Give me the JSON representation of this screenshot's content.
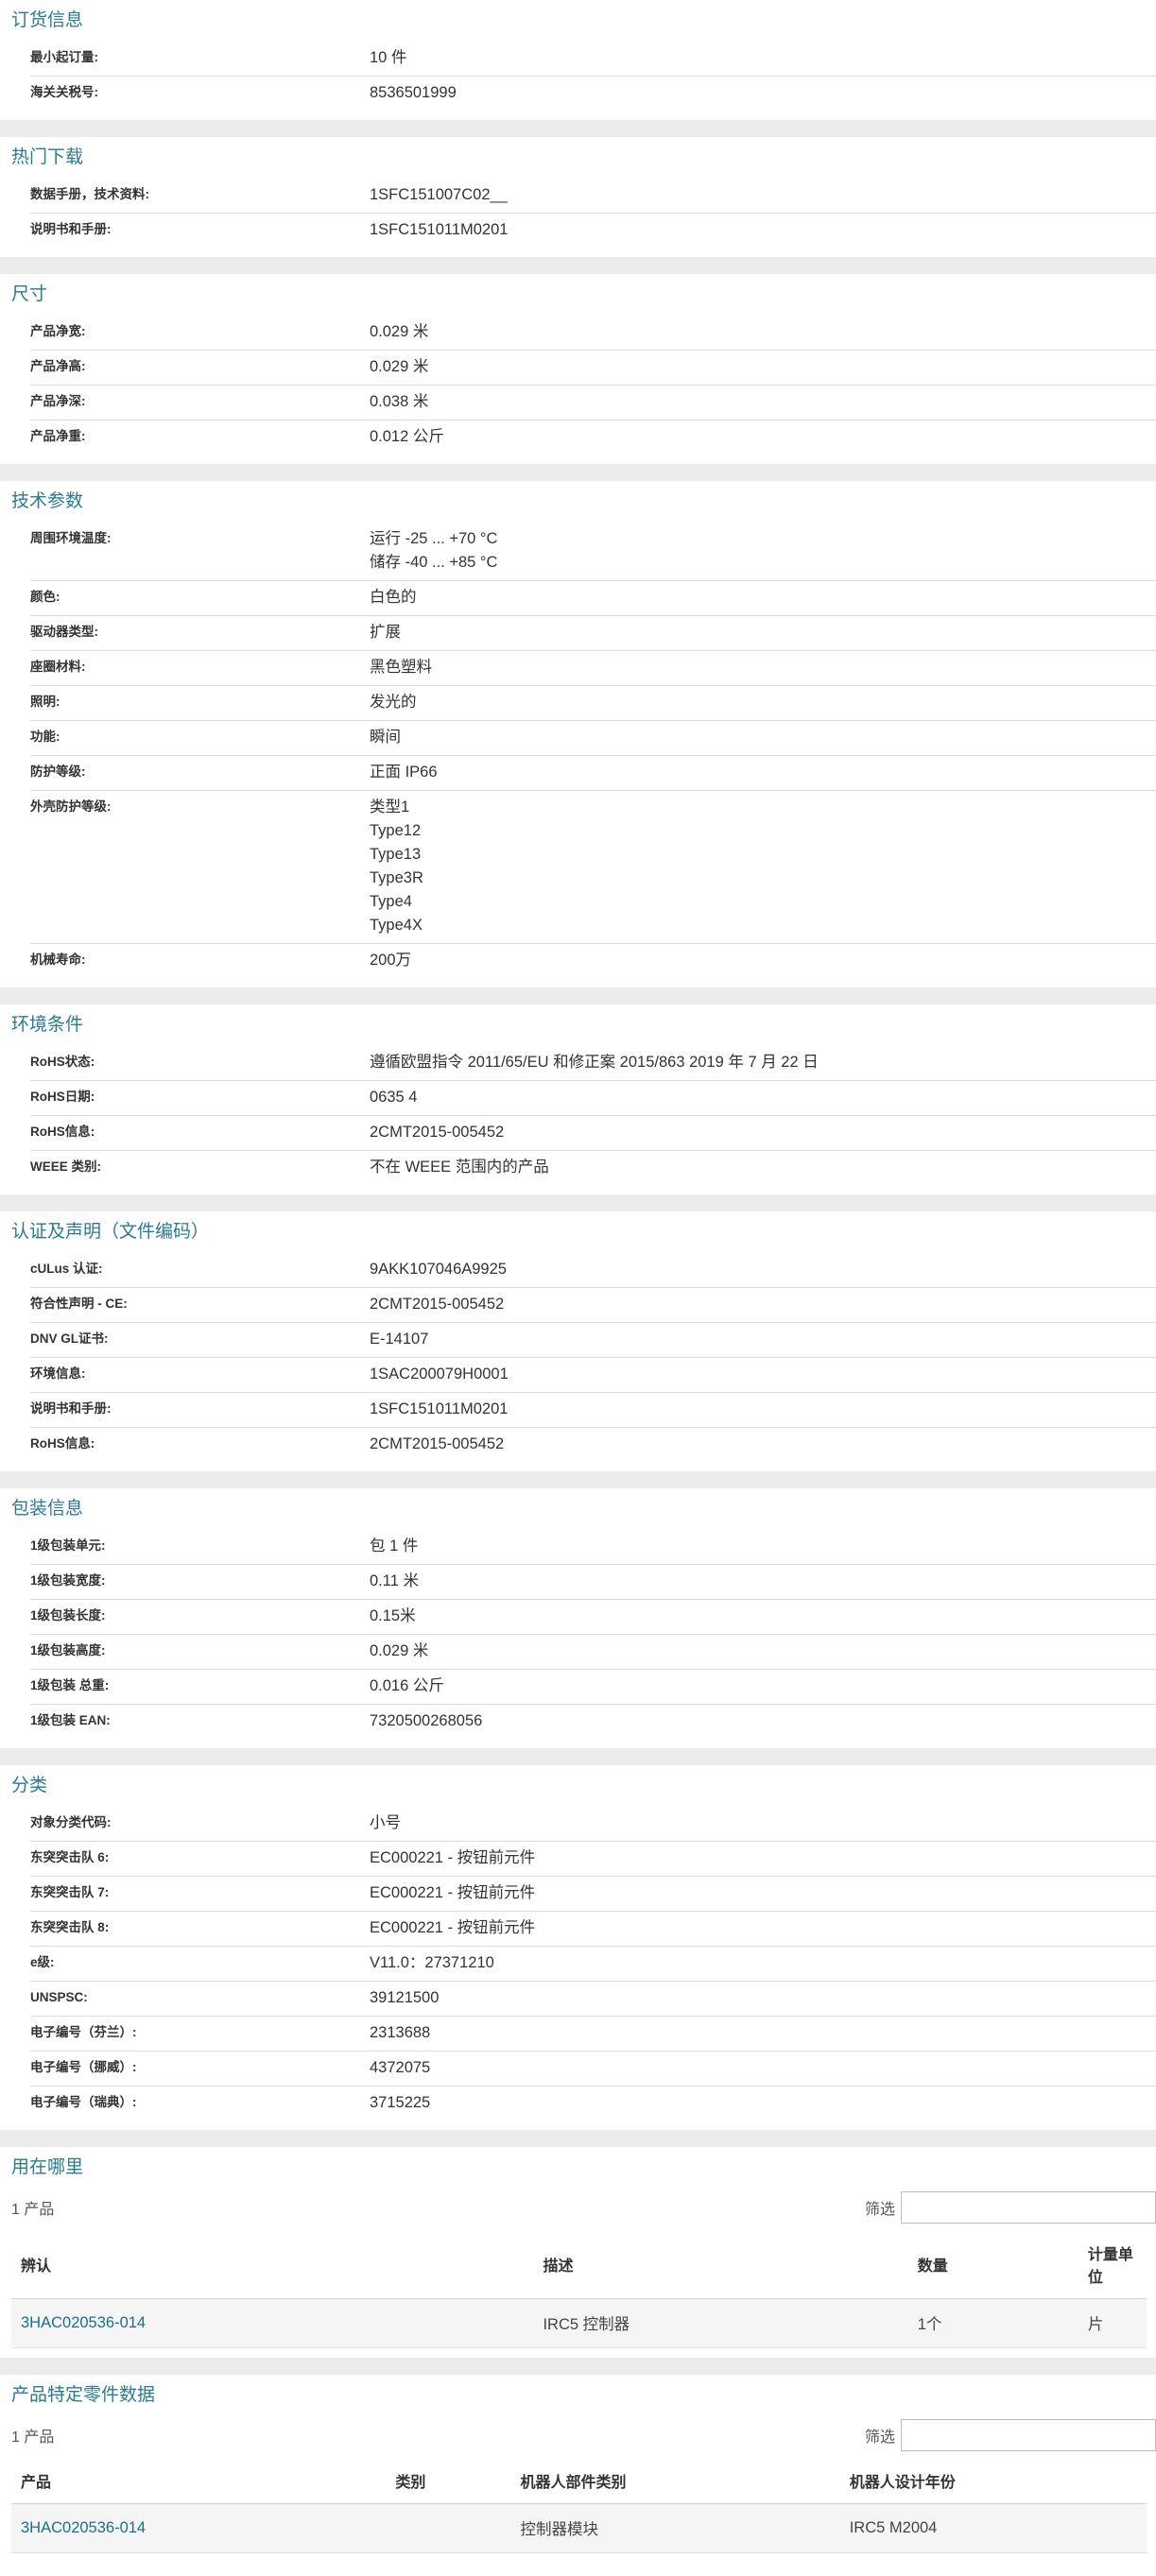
{
  "sections": {
    "ordering": {
      "title": "订货信息",
      "rows": [
        {
          "label": "最小起订量:",
          "value": "10 件"
        },
        {
          "label": "海关关税号:",
          "value": "8536501999"
        }
      ]
    },
    "downloads": {
      "title": "热门下载",
      "rows": [
        {
          "label": "数据手册，技术资料:",
          "value": "1SFC151007C02__"
        },
        {
          "label": "说明书和手册:",
          "value": "1SFC151011M0201"
        }
      ]
    },
    "dimensions": {
      "title": "尺寸",
      "rows": [
        {
          "label": "产品净宽:",
          "value": "0.029 米"
        },
        {
          "label": "产品净高:",
          "value": "0.029 米"
        },
        {
          "label": "产品净深:",
          "value": "0.038 米"
        },
        {
          "label": "产品净重:",
          "value": "0.012 公斤"
        }
      ]
    },
    "technical": {
      "title": "技术参数",
      "rows": [
        {
          "label": "周围环境温度:",
          "lines": [
            "运行 -25 ... +70 °C",
            "储存 -40 ... +85 °C"
          ]
        },
        {
          "label": "颜色:",
          "value": "白色的"
        },
        {
          "label": "驱动器类型:",
          "value": "扩展"
        },
        {
          "label": "座圈材料:",
          "value": "黑色塑料"
        },
        {
          "label": "照明:",
          "value": "发光的"
        },
        {
          "label": "功能:",
          "value": "瞬间"
        },
        {
          "label": "防护等级:",
          "value": "正面 IP66"
        },
        {
          "label": "外壳防护等级:",
          "lines": [
            "类型1",
            "Type12",
            "Type13",
            "Type3R",
            "Type4",
            "Type4X"
          ]
        },
        {
          "label": "机械寿命:",
          "value": "200万"
        }
      ]
    },
    "environment": {
      "title": "环境条件",
      "rows": [
        {
          "label": "RoHS状态:",
          "value": "遵循欧盟指令 2011/65/EU 和修正案 2015/863 2019 年 7 月 22 日"
        },
        {
          "label": "RoHS日期:",
          "value": "0635 4"
        },
        {
          "label": "RoHS信息:",
          "value": "2CMT2015-005452"
        },
        {
          "label": "WEEE 类别:",
          "value": "不在 WEEE 范围内的产品"
        }
      ]
    },
    "certifications": {
      "title": "认证及声明（文件编码）",
      "rows": [
        {
          "label": "cULus 认证:",
          "value": "9AKK107046A9925"
        },
        {
          "label": "符合性声明 - CE:",
          "value": "2CMT2015-005452"
        },
        {
          "label": "DNV GL证书:",
          "value": "E-14107"
        },
        {
          "label": "环境信息:",
          "value": "1SAC200079H0001"
        },
        {
          "label": "说明书和手册:",
          "value": "1SFC151011M0201"
        },
        {
          "label": "RoHS信息:",
          "value": "2CMT2015-005452"
        }
      ]
    },
    "packaging": {
      "title": "包装信息",
      "rows": [
        {
          "label": "1级包装单元:",
          "value": "包 1 件"
        },
        {
          "label": "1级包装宽度:",
          "value": "0.11 米"
        },
        {
          "label": "1级包装长度:",
          "value": "0.15米"
        },
        {
          "label": "1级包装高度:",
          "value": "0.029 米"
        },
        {
          "label": "1级包装 总重:",
          "value": "0.016 公斤"
        },
        {
          "label": "1级包装 EAN:",
          "value": "7320500268056"
        }
      ]
    },
    "classification": {
      "title": "分类",
      "rows": [
        {
          "label": "对象分类代码:",
          "value": "小号"
        },
        {
          "label": "东突突击队 6:",
          "value": "EC000221 - 按钮前元件"
        },
        {
          "label": "东突突击队 7:",
          "value": "EC000221 - 按钮前元件"
        },
        {
          "label": "东突突击队 8:",
          "value": "EC000221 - 按钮前元件"
        },
        {
          "label": "e级:",
          "value": "V11.0：27371210"
        },
        {
          "label": "UNSPSC:",
          "value": "39121500"
        },
        {
          "label": "电子编号（芬兰）:",
          "value": "2313688"
        },
        {
          "label": "电子编号（挪威）:",
          "value": "4372075"
        },
        {
          "label": "电子编号（瑞典）:",
          "value": "3715225"
        }
      ]
    }
  },
  "where_used": {
    "title": "用在哪里",
    "count": "1 产品",
    "filter_label": "筛选",
    "filter_value": "",
    "headers": [
      "辨认",
      "描述",
      "数量",
      "计量单位"
    ],
    "rows": [
      {
        "id": "3HAC020536-014",
        "description": "IRC5 控制器",
        "quantity": "1个",
        "unit": "片"
      }
    ]
  },
  "product_parts": {
    "title": "产品特定零件数据",
    "count": "1 产品",
    "filter_label": "筛选",
    "filter_value": "",
    "headers": [
      "产品",
      "类别",
      "机器人部件类别",
      "机器人设计年份"
    ],
    "rows": [
      {
        "product": "3HAC020536-014",
        "category": "",
        "part_category": "控制器模块",
        "design_year": "IRC5 M2004"
      }
    ]
  }
}
